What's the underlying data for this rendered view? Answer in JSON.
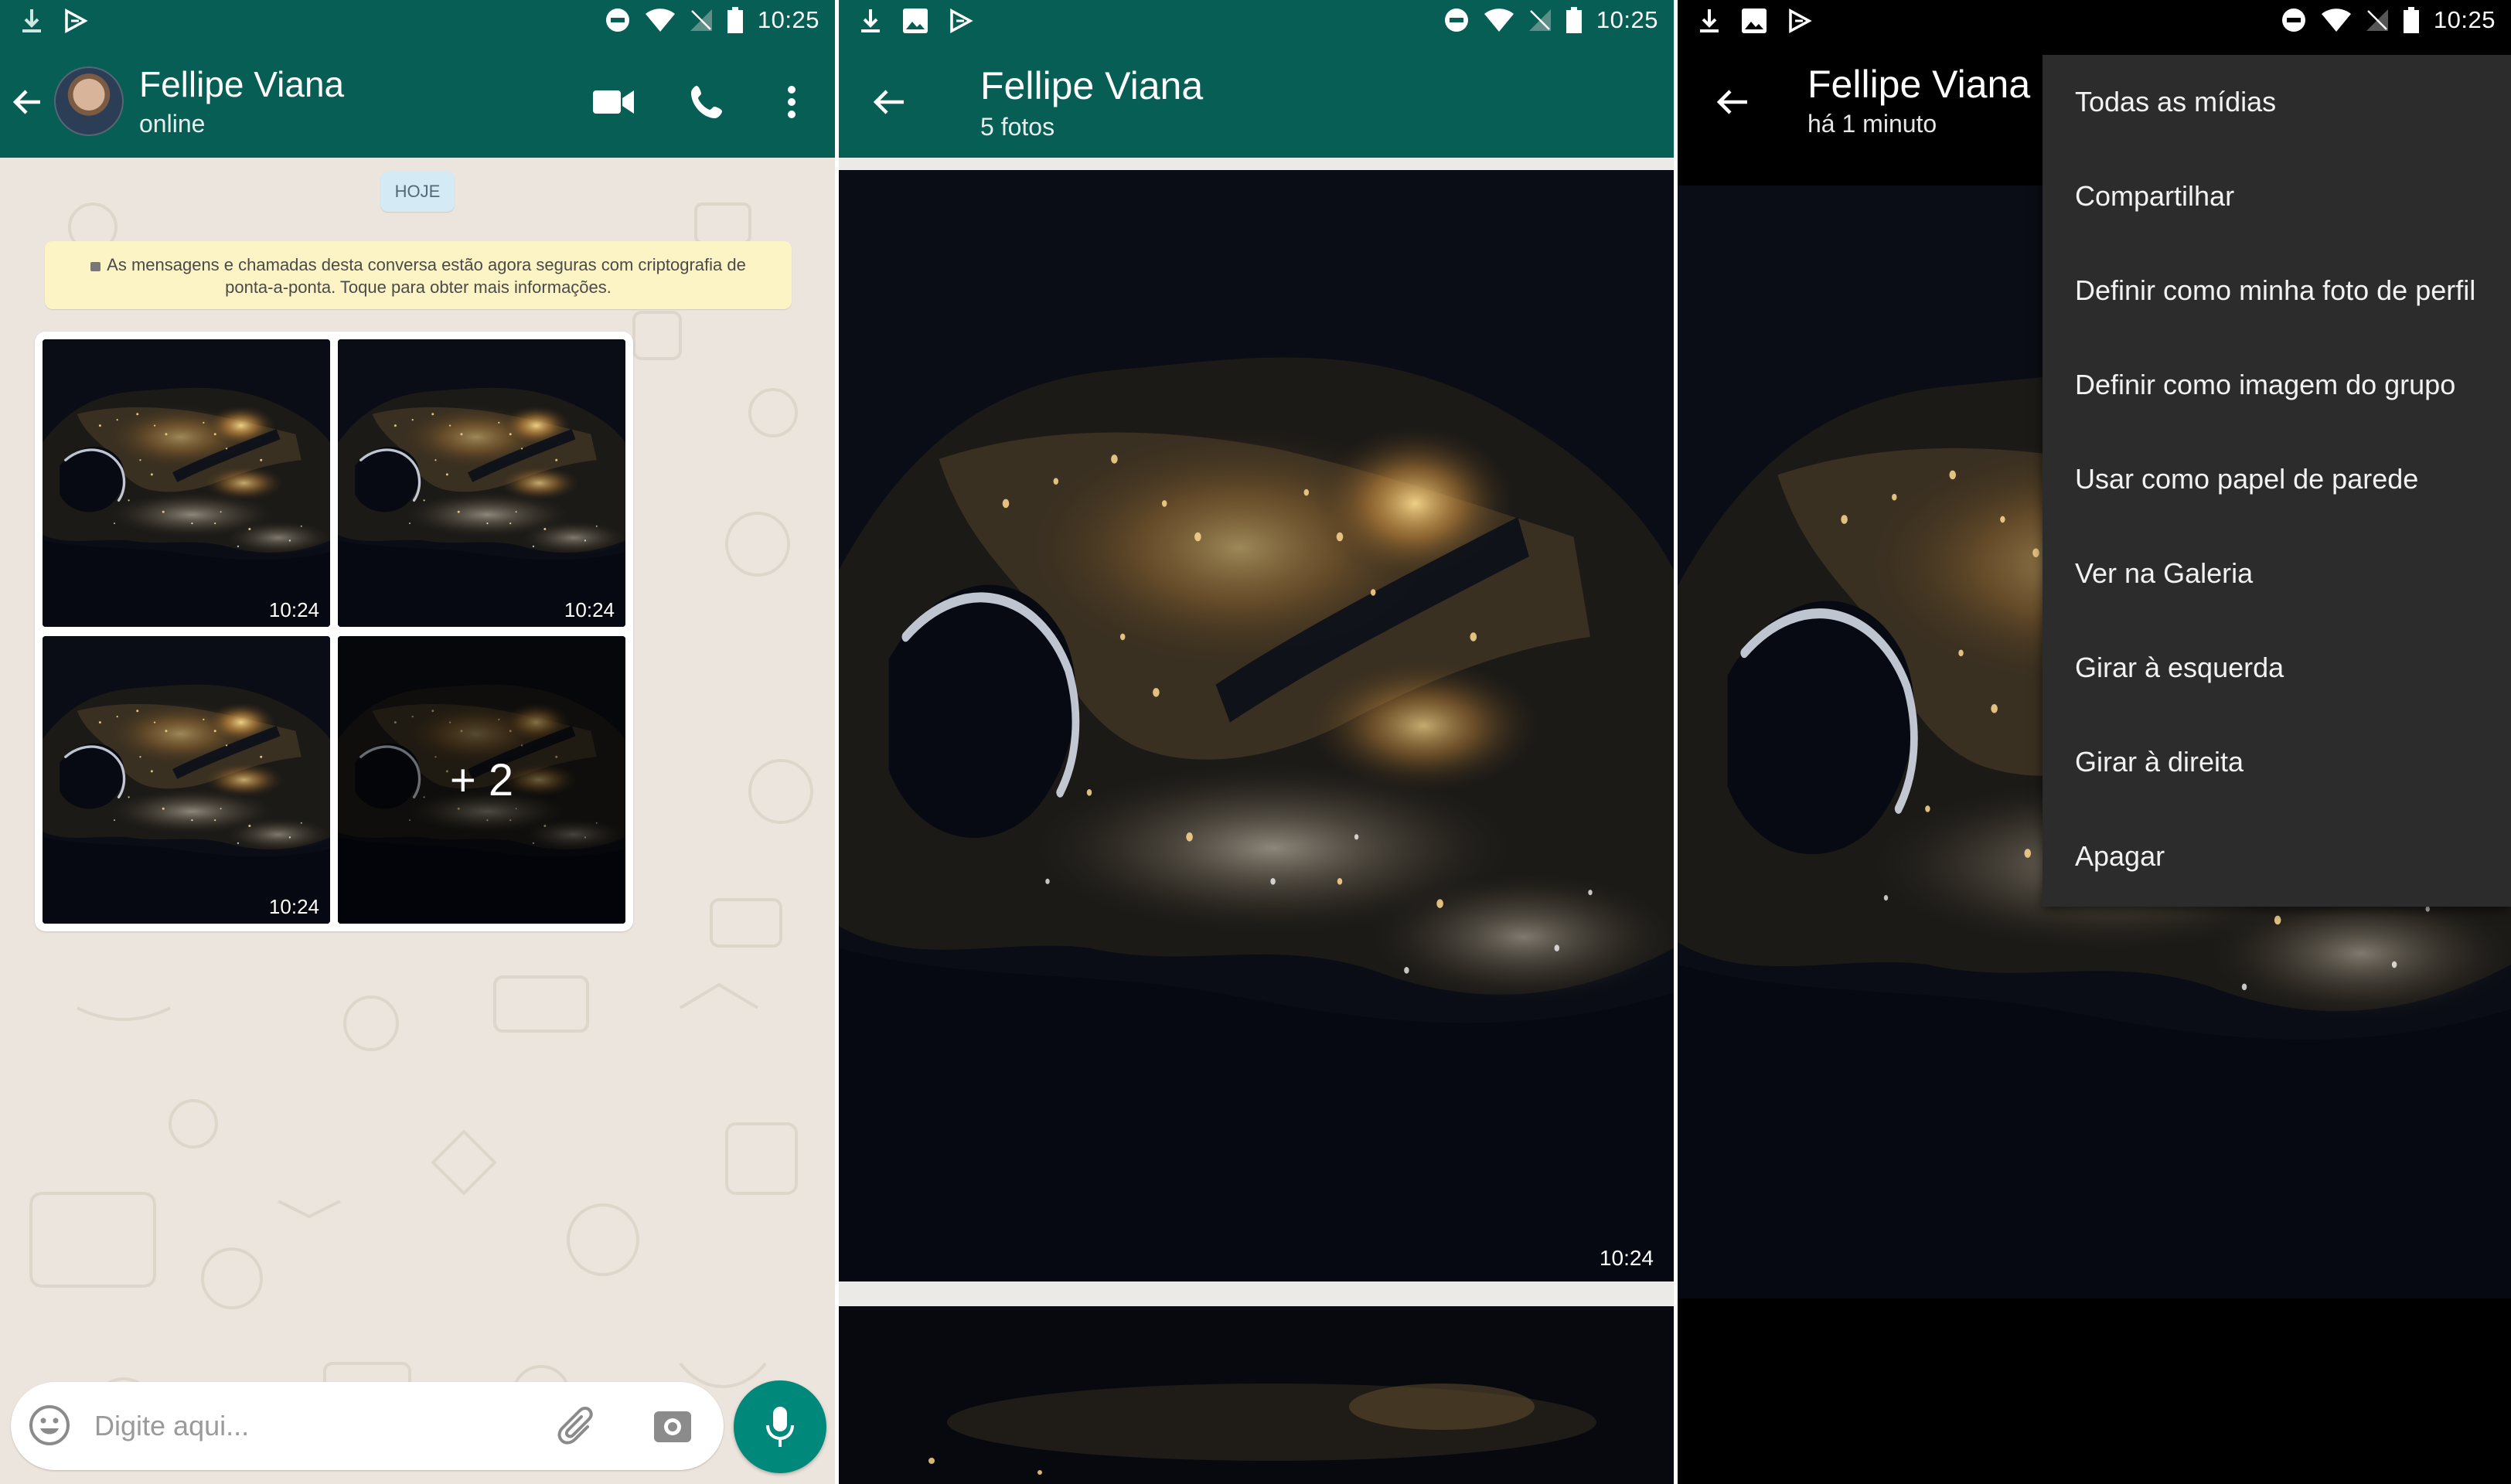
{
  "status_bar": {
    "time": "10:25"
  },
  "chat": {
    "contact_name": "Fellipe Viana",
    "contact_status": "online",
    "date_chip": "HOJE",
    "encryption_notice": "As mensagens e chamadas desta conversa estão agora seguras com criptografia de ponta-a-ponta. Toque para obter mais informações.",
    "album": {
      "photos": [
        {
          "time": "10:24"
        },
        {
          "time": "10:24"
        },
        {
          "time": "10:24"
        },
        {
          "more_label": "+ 2"
        }
      ]
    },
    "composer": {
      "placeholder": "Digite aqui..."
    },
    "icons": {
      "back": "arrow-left-icon",
      "video": "videocam-icon",
      "call": "phone-icon",
      "menu": "more-vert-icon",
      "emoji": "emoji-icon",
      "attach": "paperclip-icon",
      "camera": "camera-icon",
      "mic": "mic-icon"
    }
  },
  "media_list": {
    "title": "Fellipe Viana",
    "subtitle": "5 fotos",
    "photo_time": "10:24"
  },
  "photo_viewer": {
    "title": "Fellipe Viana",
    "subtitle": "há 1 minuto",
    "menu": [
      "Todas as mídias",
      "Compartilhar",
      "Definir como minha foto de perfil",
      "Definir como imagem do grupo",
      "Usar como papel de parede",
      "Ver na Galeria",
      "Girar à esquerda",
      "Girar à direita",
      "Apagar"
    ]
  },
  "colors": {
    "whatsapp_header": "#075e54",
    "whatsapp_accent": "#00897b",
    "chat_background": "#ece5dd",
    "encryption_bg": "#fdf4c5",
    "menu_bg": "#2c2c2c"
  }
}
